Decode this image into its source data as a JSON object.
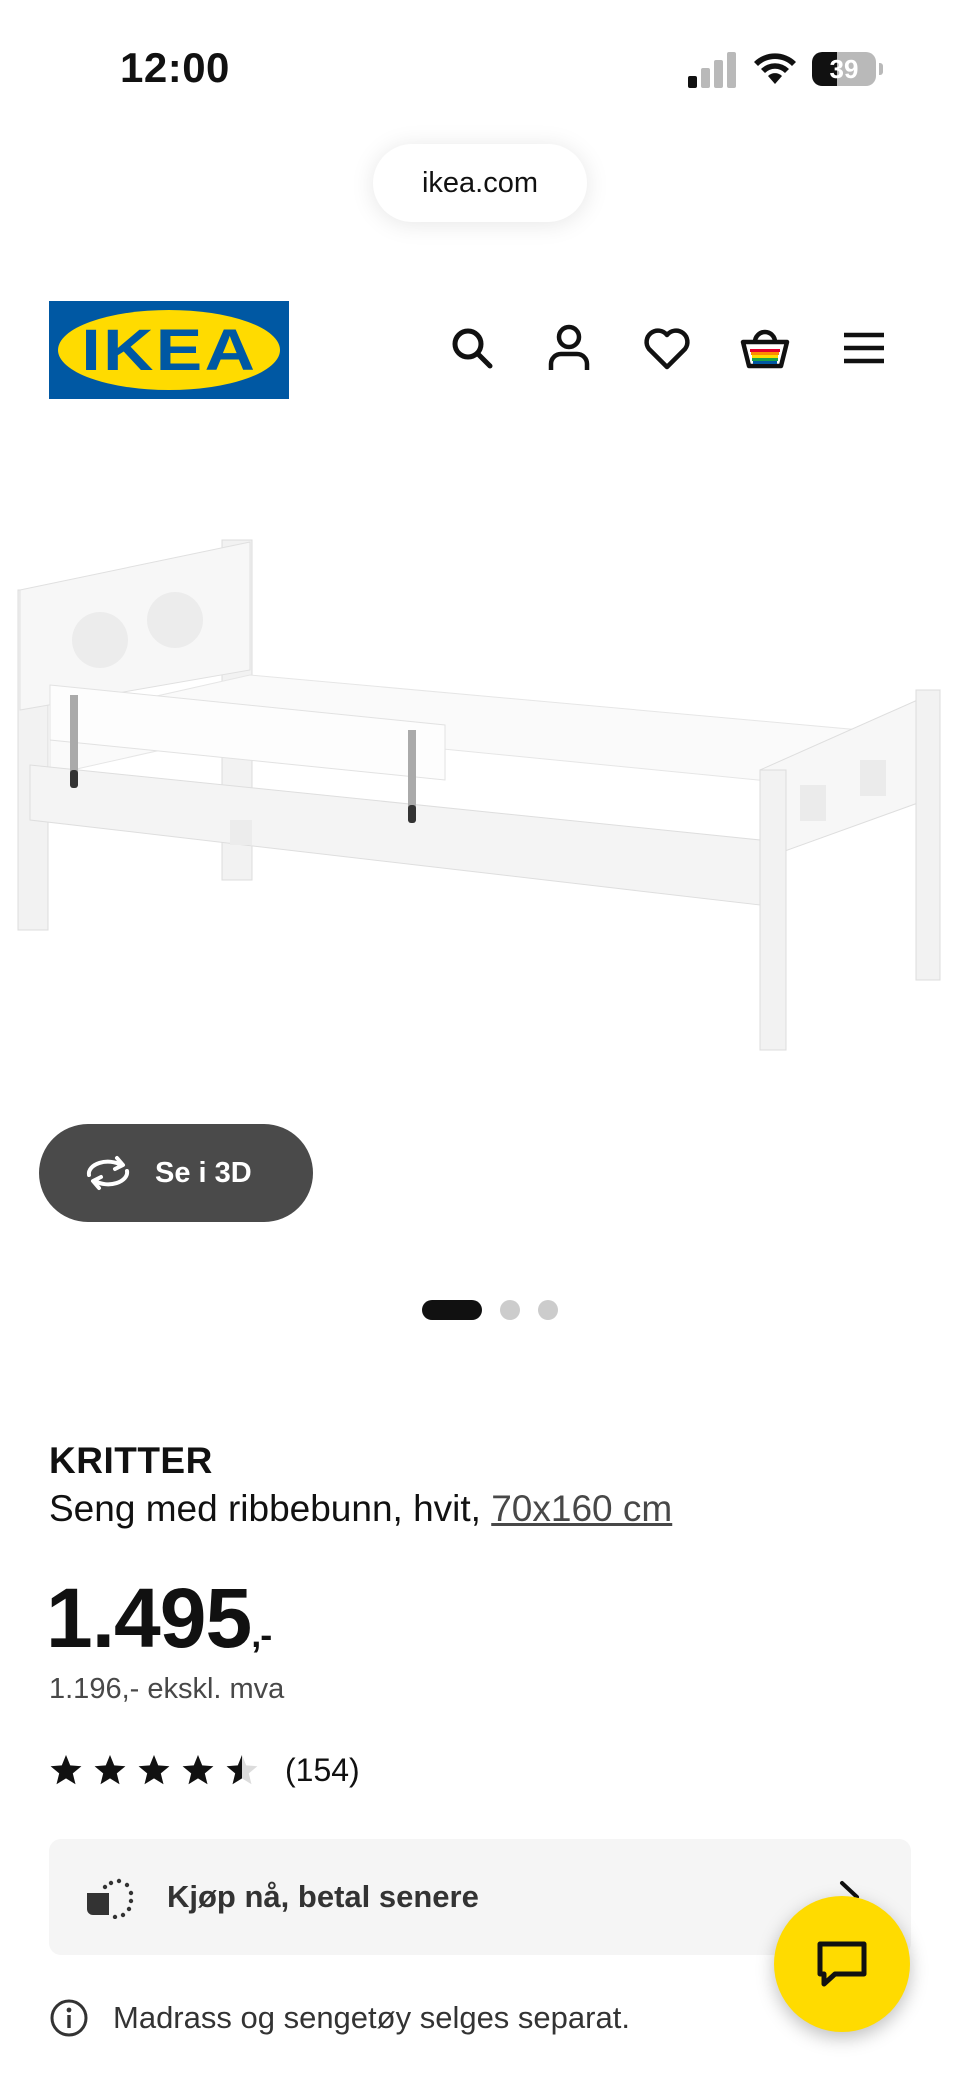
{
  "status_bar": {
    "time": "12:00",
    "battery": "39",
    "battery_level_percent": 39
  },
  "browser": {
    "url": "ikea.com"
  },
  "header": {
    "logo_text": "IKEA",
    "brand_colors": {
      "blue": "#0058a3",
      "yellow": "#ffdb00"
    },
    "icons": [
      "search-icon",
      "account-icon",
      "heart-icon",
      "cart-icon",
      "menu-icon"
    ]
  },
  "gallery": {
    "view_3d_label": "Se i 3D",
    "total_images": 3,
    "active_image": 1
  },
  "product": {
    "name": "KRITTER",
    "description": "Seng med ribbebunn, hvit, ",
    "size_link": "70x160 cm",
    "price": "1.495",
    "price_suffix": ",-",
    "price_ex_vat": "1.196,- ekskl. mva",
    "rating_value": 4.5,
    "rating_max": 5,
    "rating_count": "(154)"
  },
  "pay_later": {
    "label": "Kjøp nå, betal senere"
  },
  "notice": {
    "text": "Madrass og sengetøy selges separat."
  },
  "chat": {
    "icon": "chat-icon",
    "color": "#ffdb00"
  }
}
